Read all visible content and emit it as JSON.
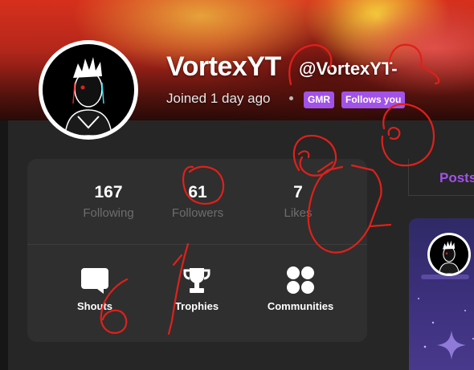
{
  "profile": {
    "display_name": "VortexYT",
    "handle": "@VortexYT-",
    "joined": "Joined 1 day ago",
    "badges": {
      "gmr": "GMR",
      "follows_you": "Follows you"
    }
  },
  "stats": {
    "following": {
      "count": "167",
      "label": "Following"
    },
    "followers": {
      "count": "61",
      "label": "Followers"
    },
    "likes": {
      "count": "7",
      "label": "Likes"
    }
  },
  "actions": {
    "shouts": "Shouts",
    "trophies": "Trophies",
    "communities": "Communities"
  },
  "tabs": {
    "posts": "Posts"
  },
  "colors": {
    "accent": "#a152e8",
    "annotation": "#e0201a"
  },
  "icons": [
    "shouts-icon",
    "trophy-icon",
    "communities-icon",
    "sparkle-icon"
  ]
}
